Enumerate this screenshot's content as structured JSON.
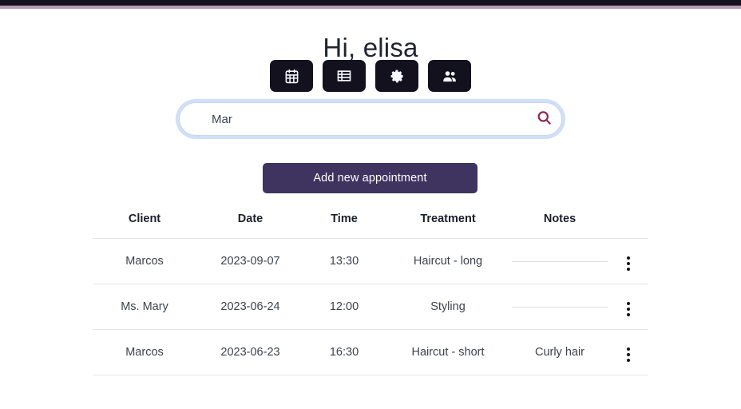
{
  "theme": {
    "topbar_dark": "#15111e",
    "topbar_accent": "#b49ab4",
    "icon_button_bg": "#14111f",
    "primary_button_bg": "#3f3460",
    "search_icon_color": "#8c1f52",
    "focus_ring": "#a7c7f3"
  },
  "header": {
    "greeting": "Hi, elisa"
  },
  "nav": {
    "buttons": [
      {
        "icon": "calendar-icon",
        "label": "Calendar"
      },
      {
        "icon": "table-list-icon",
        "label": "Appointments list"
      },
      {
        "icon": "gear-icon",
        "label": "Settings"
      },
      {
        "icon": "users-icon",
        "label": "Clients"
      }
    ]
  },
  "search": {
    "value": "Mar",
    "placeholder": "Search",
    "icon": "search-icon"
  },
  "actions": {
    "add_appointment_label": "Add new appointment"
  },
  "table": {
    "columns": [
      "Client",
      "Date",
      "Time",
      "Treatment",
      "Notes"
    ],
    "row_menu_icon": "kebab-menu-icon",
    "rows": [
      {
        "client": "Marcos",
        "date": "2023-09-07",
        "time": "13:30",
        "treatment": "Haircut - long",
        "notes": ""
      },
      {
        "client": "Ms. Mary",
        "date": "2023-06-24",
        "time": "12:00",
        "treatment": "Styling",
        "notes": ""
      },
      {
        "client": "Marcos",
        "date": "2023-06-23",
        "time": "16:30",
        "treatment": "Haircut - short",
        "notes": "Curly hair"
      }
    ]
  }
}
